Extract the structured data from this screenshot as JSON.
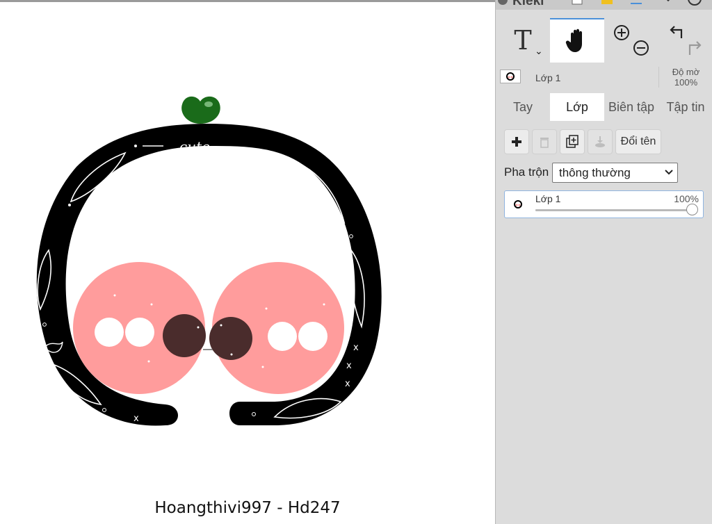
{
  "app": {
    "brand": "Kleki"
  },
  "canvas": {
    "caption": "Hoangthivi997 - Hd247",
    "doodle_word": "cute"
  },
  "tools": {
    "text_label": "T",
    "caret": "⌄"
  },
  "layer_header": {
    "name": "Lớp 1",
    "opacity_label": "Độ mờ",
    "opacity_value": "100%"
  },
  "tabs": [
    {
      "label": "Tay"
    },
    {
      "label": "Lớp"
    },
    {
      "label": "Biên tập"
    },
    {
      "label": "Tập tin"
    }
  ],
  "active_tab": "Lớp",
  "layer_actions": {
    "rename_label": "Đổi tên"
  },
  "blend": {
    "label": "Pha trộn",
    "value": "thông thường"
  },
  "layers": [
    {
      "name": "Lớp 1",
      "opacity_text": "100%",
      "opacity": 1.0
    }
  ],
  "colors": {
    "panel_bg": "#dcdcdc",
    "accent": "#4a90d9",
    "ring": "#000000",
    "cheek": "#ff9c9c",
    "eye_dark": "#4a2c2c",
    "leaf": "#1a6b1a"
  }
}
